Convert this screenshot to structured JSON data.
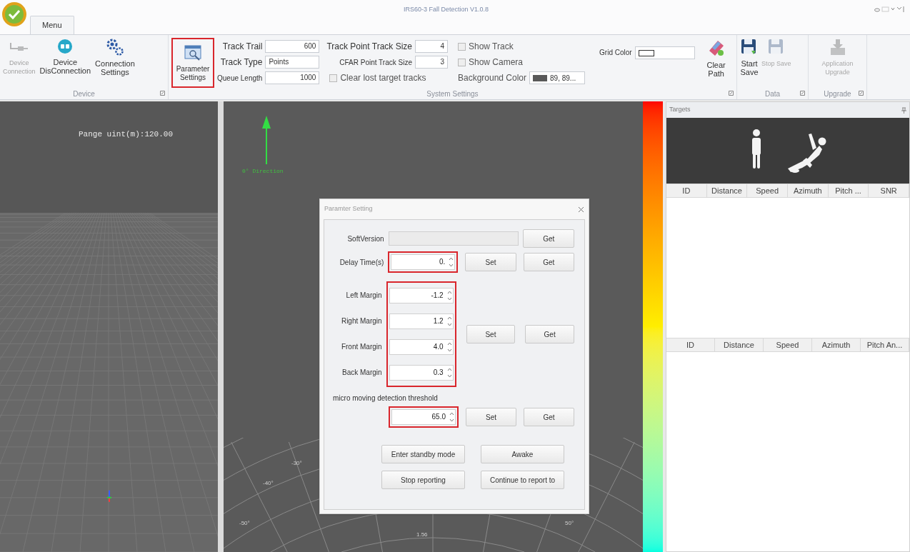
{
  "window": {
    "title": "IRS60-3 Fall Detection V1.0.8"
  },
  "tabs": [
    {
      "label": "Menu",
      "selected": true
    }
  ],
  "ribbon": {
    "device": {
      "label": "Device",
      "buttons": [
        {
          "label": "Device\nConnection",
          "disabled": true
        },
        {
          "label": "Device\nDisConnection",
          "disabled": false
        },
        {
          "label": "Connection\nSettings",
          "disabled": false
        }
      ]
    },
    "system_settings": {
      "label": "System Settings",
      "parameter_button": {
        "label": "Parameter\nSettings",
        "highlighted": true
      },
      "column_1": [
        {
          "label": "Track Trail",
          "value": "600"
        },
        {
          "label": "Track Type",
          "value": "Points"
        },
        {
          "label": "Queue Length",
          "value": "1000"
        }
      ],
      "column_2": [
        {
          "kind": "field",
          "label": "Track Point Track Size",
          "value": "4"
        },
        {
          "kind": "field",
          "label": "CFAR  Point Track Size",
          "value": "3"
        },
        {
          "kind": "checkbox",
          "label": "Clear lost target tracks",
          "checked": false
        }
      ],
      "column_3": [
        {
          "kind": "checkbox",
          "label": "Show Track",
          "checked": false
        },
        {
          "kind": "checkbox",
          "label": "Show Camera",
          "checked": false
        },
        {
          "kind": "color",
          "label": "Background Color",
          "value": "89, 89...",
          "color": "#595959"
        }
      ],
      "grid_color": {
        "label": "Grid Color",
        "color": "#ffffff"
      },
      "clear_path": {
        "label": "Clear\nPath"
      }
    },
    "data": {
      "label": "Data",
      "buttons": [
        {
          "label": "Start\nSave",
          "disabled": false
        },
        {
          "label": "Stop Save",
          "disabled": true
        }
      ]
    },
    "upgrade": {
      "label": "Upgrade",
      "buttons": [
        {
          "label": "Application\nUpgrade",
          "disabled": true
        }
      ]
    }
  },
  "left_view": {
    "range_label": "Pange uint(m):120.00"
  },
  "center_view": {
    "direction_label": "0° Direction",
    "polar_labels": [
      "-30°",
      "-40°",
      "-50°",
      "1.56",
      "50°"
    ]
  },
  "dialog": {
    "title": "Paramter Setting",
    "soft_version": {
      "label": "SoftVersion",
      "button": "Get"
    },
    "delay": {
      "label": "Delay Time(s)",
      "value": "0.",
      "highlighted": true,
      "buttons": [
        "Set",
        "Get"
      ]
    },
    "margins": {
      "highlighted": true,
      "fields": [
        {
          "label": "Left Margin",
          "value": "-1.2"
        },
        {
          "label": "Right Margin",
          "value": "1.2"
        },
        {
          "label": "Front Margin",
          "value": "4.0"
        },
        {
          "label": "Back Margin",
          "value": "0.3"
        }
      ],
      "buttons": [
        "Set",
        "Get"
      ]
    },
    "threshold": {
      "label": "micro moving detection threshold",
      "value": "65.0",
      "highlighted": true,
      "buttons": [
        "Set",
        "Get"
      ]
    },
    "actions": [
      "Enter standby mode",
      "Awake",
      "Stop reporting",
      "Continue to report to"
    ]
  },
  "targets_panel": {
    "title": "Targets",
    "table_1": {
      "columns": [
        "ID",
        "Distance",
        "Speed",
        "Azimuth",
        "Pitch ...",
        "SNR"
      ]
    },
    "table_2": {
      "columns": [
        "ID",
        "Distance",
        "Speed",
        "Azimuth",
        "Pitch An..."
      ]
    }
  }
}
